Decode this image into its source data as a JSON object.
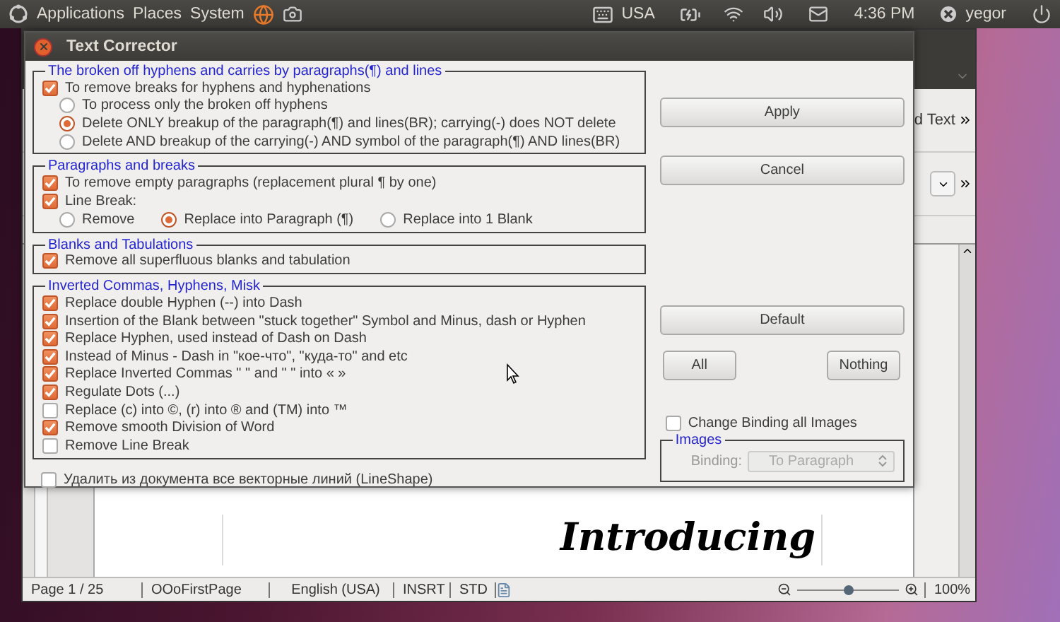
{
  "top_panel": {
    "menus": [
      "Applications",
      "Places",
      "System"
    ],
    "keyboard_layout": "USA",
    "clock": "4:36 PM",
    "user": "yegor"
  },
  "writer": {
    "toolbar_text": "d Text",
    "document_lines": [
      "Introducing"
    ],
    "status_bar": {
      "page": "Page 1 / 25",
      "page_style": "OOoFirstPage",
      "language": "English (USA)",
      "insert_mode": "INSRT",
      "selection_mode": "STD",
      "zoom": {
        "level": 0.5,
        "value": "100%"
      }
    }
  },
  "dialog": {
    "title": "Text Corrector",
    "groups": [
      {
        "title": "The broken off hyphens and carries by paragraphs(¶) and lines",
        "items": [
          {
            "kind": "checkbox",
            "label": "To remove breaks for hyphens and hyphenations",
            "checked": true
          },
          {
            "kind": "radio",
            "label": "To process only the broken off hyphens",
            "selected": false
          },
          {
            "kind": "radio",
            "label": "Delete ONLY breakup of the paragraph(¶) and lines(BR); carrying(-) does NOT delete",
            "selected": true
          },
          {
            "kind": "radio",
            "label": "Delete AND breakup of the carrying(-) AND symbol of the paragraph(¶) AND lines(BR)",
            "selected": false
          }
        ]
      },
      {
        "title": "Paragraphs and breaks",
        "items": [
          {
            "kind": "checkbox",
            "label": "To remove empty paragraphs (replacement plural ¶ by one)",
            "checked": true
          },
          {
            "kind": "checkbox",
            "label": "Line Break:",
            "checked": true
          },
          {
            "kind": "radio-row",
            "options": [
              {
                "label": "Remove",
                "selected": false
              },
              {
                "label": "Replace into Paragraph (¶)",
                "selected": true
              },
              {
                "label": "Replace into 1 Blank",
                "selected": false
              }
            ]
          }
        ]
      },
      {
        "title": "Blanks and Tabulations",
        "items": [
          {
            "kind": "checkbox",
            "label": "Remove all superfluous blanks and tabulation",
            "checked": true
          }
        ]
      },
      {
        "title": "Inverted Commas, Hyphens, Misk",
        "items": [
          {
            "kind": "checkbox",
            "label": "Replace double Hyphen (--) into Dash",
            "checked": true
          },
          {
            "kind": "checkbox",
            "label": "Insertion of the Blank between \"stuck together\" Symbol and Minus, dash or Hyphen",
            "checked": true
          },
          {
            "kind": "checkbox",
            "label": "Replace Hyphen, used instead of Dash on Dash",
            "checked": true
          },
          {
            "kind": "checkbox",
            "label": "Instead of Minus - Dash in \"кое-что\", \"куда-то\" and etc",
            "checked": true
          },
          {
            "kind": "checkbox",
            "label": "Replace Inverted Commas  \" \" and \" \" into  « »",
            "checked": true
          },
          {
            "kind": "checkbox",
            "label": "Regulate Dots (...)",
            "checked": true
          },
          {
            "kind": "checkbox",
            "label": "Replace (c) into ©, (r) into ® and (TM) into ™",
            "checked": false
          },
          {
            "kind": "checkbox",
            "label": "Remove  smooth Division of Word",
            "checked": true
          },
          {
            "kind": "checkbox",
            "label": "Remove Line Break",
            "checked": false
          }
        ]
      }
    ],
    "bottom_option": {
      "label": "Удалить из документа все векторные линий (LineShape)",
      "checked": false
    },
    "buttons": {
      "apply": "Apply",
      "cancel": "Cancel",
      "default": "Default",
      "all": "All",
      "nothing": "Nothing"
    },
    "change_binding": {
      "label": "Change Binding all Images",
      "checked": false
    },
    "images": {
      "title": "Images",
      "binding_label": "Binding:",
      "binding_value": "To Paragraph",
      "disabled": true
    }
  }
}
